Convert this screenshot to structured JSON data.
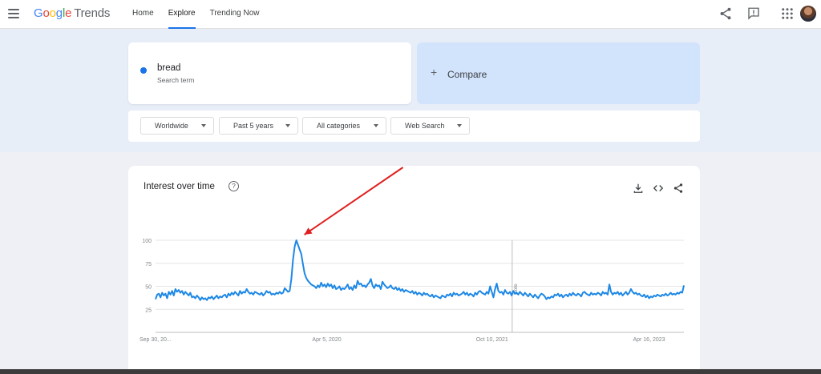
{
  "app": {
    "logo_google": "Google",
    "logo_trends": "Trends"
  },
  "nav": {
    "home": "Home",
    "explore": "Explore",
    "trending_now": "Trending Now"
  },
  "top_icons": [
    "share-icon",
    "feedback-icon",
    "apps-grid-icon",
    "avatar"
  ],
  "search": {
    "term": "bread",
    "term_sub": "Search term",
    "term_color": "#1a73e8",
    "compare_label": "Compare"
  },
  "filters": [
    {
      "label": "Worldwide"
    },
    {
      "label": "Past 5 years"
    },
    {
      "label": "All categories"
    },
    {
      "label": "Web Search"
    }
  ],
  "chart": {
    "title": "Interest over time",
    "icons": [
      "download-icon",
      "embed-icon",
      "share-icon"
    ],
    "note_label": "Note"
  },
  "chart_data": {
    "type": "line",
    "x_ticks": [
      "Sep 30, 20...",
      "Apr 5, 2020",
      "Oct 10, 2021",
      "Apr 16, 2023"
    ],
    "y_ticks": [
      100,
      75,
      50,
      25
    ],
    "ylim": [
      0,
      100
    ],
    "grid": true,
    "line_color": "#1e88e5",
    "series": [
      {
        "values": [
          36,
          41,
          42,
          38,
          43,
          40,
          42,
          37,
          44,
          41,
          45,
          40,
          47,
          44,
          46,
          43,
          45,
          41,
          44,
          42,
          40,
          43,
          38,
          39,
          37,
          40,
          38,
          35,
          38,
          36,
          37,
          35,
          38,
          37,
          39,
          36,
          38,
          40,
          37,
          39,
          38,
          40,
          41,
          38,
          42,
          40,
          43,
          41,
          44,
          42,
          40,
          45,
          42,
          44,
          43,
          47,
          44,
          42,
          43,
          41,
          44,
          43,
          42,
          41,
          43,
          40,
          42,
          45,
          43,
          44,
          41,
          42,
          41,
          43,
          42,
          44,
          42,
          43,
          48,
          46,
          44,
          45,
          58,
          79,
          93,
          100,
          95,
          90,
          85,
          74,
          64,
          59,
          56,
          54,
          52,
          51,
          50,
          48,
          51,
          49,
          54,
          50,
          52,
          49,
          53,
          50,
          52,
          48,
          51,
          47,
          48,
          50,
          46,
          48,
          47,
          49,
          52,
          47,
          49,
          46,
          51,
          48,
          56,
          52,
          53,
          50,
          51,
          49,
          52,
          54,
          58,
          51,
          48,
          52,
          50,
          51,
          47,
          55,
          52,
          50,
          48,
          49,
          51,
          48,
          47,
          49,
          46,
          48,
          45,
          47,
          44,
          46,
          45,
          44,
          43,
          45,
          42,
          44,
          41,
          43,
          42,
          40,
          43,
          41,
          42,
          40,
          39,
          41,
          38,
          40,
          39,
          38,
          37,
          40,
          39,
          38,
          41,
          40,
          42,
          39,
          43,
          41,
          42,
          40,
          41,
          42,
          44,
          41,
          43,
          40,
          42,
          41,
          39,
          43,
          41,
          44,
          45,
          43,
          42,
          41,
          44,
          42,
          50,
          44,
          38,
          47,
          53,
          45,
          43,
          44,
          41,
          46,
          43,
          42,
          44,
          40,
          45,
          42,
          43,
          41,
          44,
          42,
          40,
          43,
          41,
          39,
          42,
          40,
          38,
          41,
          39,
          37,
          40,
          42,
          41,
          39,
          36,
          38,
          37,
          39,
          38,
          41,
          40,
          42,
          39,
          41,
          38,
          40,
          41,
          39,
          42,
          40,
          43,
          41,
          40,
          42,
          41,
          39,
          43,
          44,
          42,
          41,
          40,
          43,
          41,
          42,
          41,
          43,
          42,
          40,
          44,
          42,
          43,
          41,
          52,
          44,
          41,
          43,
          42,
          44,
          41,
          43,
          40,
          42,
          44,
          41,
          43,
          47,
          44,
          42,
          43,
          41,
          42,
          40,
          39,
          41,
          38,
          40,
          37,
          39,
          38,
          40,
          39,
          41,
          40,
          39,
          41,
          40,
          42,
          40,
          41,
          43,
          41,
          42,
          41,
          43,
          42,
          44,
          43,
          51
        ]
      }
    ]
  }
}
